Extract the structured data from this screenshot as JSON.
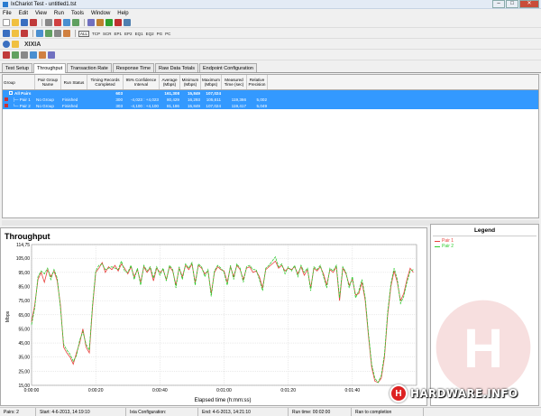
{
  "window": {
    "title": "IxChariot Test - untitled1.tst",
    "min": "–",
    "max": "□",
    "close": "✕"
  },
  "menu": [
    "File",
    "Edit",
    "View",
    "Run",
    "Tools",
    "Window",
    "Help"
  ],
  "toolbar_protocols": [
    "ALL",
    "TCP",
    "SCR",
    "EP1",
    "EP2",
    "EQ1",
    "EQ2",
    "PG",
    "PC"
  ],
  "brand": "XIXIA",
  "tabs": [
    "Test Setup",
    "Throughput",
    "Transaction Rate",
    "Response Time",
    "Raw Data Totals",
    "Endpoint Configuration"
  ],
  "active_tab": "Throughput",
  "grid": {
    "columns": [
      "Group",
      "Pair Group Name",
      "Run Status",
      "Timing Records Completed",
      "95% Confidence Interval",
      "Average (Mbps)",
      "Minimum (Mbps)",
      "Maximum (Mbps)",
      "Measured Time (sec)",
      "Relative Precision"
    ],
    "rows": [
      {
        "group": "All Pairs",
        "pair_group": "",
        "run_status": "",
        "timing": "603",
        "confidence": "",
        "avg": "161,308",
        "min": "15,849",
        "max": "107,024",
        "time": "",
        "precision": ""
      },
      {
        "group": "Pair 1",
        "pair_group": "No Group",
        "run_status": "Finished",
        "timing": "300",
        "confidence": "-4,023 : +4,023",
        "avg": "80,429",
        "min": "16,293",
        "max": "105,611",
        "time": "119,366",
        "precision": "5,002"
      },
      {
        "group": "Pair 2",
        "pair_group": "No Group",
        "run_status": "Finished",
        "timing": "303",
        "confidence": "-4,100 : +4,100",
        "avg": "81,186",
        "min": "15,849",
        "max": "107,024",
        "time": "119,417",
        "precision": "5,049"
      }
    ]
  },
  "legend": {
    "title": "Legend"
  },
  "colors": {
    "pair1": "#e8413c",
    "pair2": "#2ecc2e",
    "selection": "#3399ff"
  },
  "chart_data": {
    "type": "line",
    "title": "Throughput",
    "xlabel": "Elapsed time (h:mm:ss)",
    "ylabel": "Mbps",
    "ylim": [
      15,
      114.75
    ],
    "yticks": [
      "114,75",
      "105,00",
      "95,00",
      "85,00",
      "75,00",
      "65,00",
      "55,00",
      "45,00",
      "35,00",
      "25,00",
      "15,00"
    ],
    "xticks": [
      "0:00:00",
      "0:00:20",
      "0:00:40",
      "0:01:00",
      "0:01:20",
      "0:01:40"
    ],
    "xlim_sec": [
      0,
      120
    ],
    "grid": true,
    "legend_position": "right-pane",
    "series": [
      {
        "name": "Pair 1",
        "x": [
          0,
          1,
          2,
          3,
          4,
          5,
          6,
          7,
          8,
          9,
          10,
          11,
          12,
          13,
          14,
          15,
          16,
          17,
          18,
          19,
          20,
          21,
          22,
          23,
          24,
          25,
          26,
          27,
          28,
          29,
          30,
          31,
          32,
          33,
          34,
          35,
          36,
          37,
          38,
          39,
          40,
          41,
          42,
          43,
          44,
          45,
          46,
          47,
          48,
          49,
          50,
          51,
          52,
          53,
          54,
          55,
          56,
          57,
          58,
          59,
          60,
          61,
          62,
          63,
          64,
          65,
          66,
          67,
          68,
          69,
          70,
          71,
          72,
          73,
          74,
          75,
          76,
          77,
          78,
          79,
          80,
          81,
          82,
          83,
          84,
          85,
          86,
          87,
          88,
          89,
          90,
          91,
          92,
          93,
          94,
          95,
          96,
          97,
          98,
          99,
          100,
          101,
          102,
          103,
          104,
          105,
          106,
          107,
          108,
          109,
          110,
          111,
          112,
          113,
          114,
          115,
          116,
          117,
          118,
          119
        ],
        "values": [
          60,
          72,
          90,
          95,
          88,
          97,
          92,
          96,
          89,
          72,
          42,
          38,
          35,
          30,
          38,
          45,
          55,
          42,
          38,
          70,
          95,
          98,
          102,
          95,
          99,
          97,
          100,
          96,
          101,
          98,
          94,
          99,
          92,
          97,
          88,
          99,
          95,
          98,
          89,
          98,
          95,
          97,
          90,
          99,
          96,
          86,
          98,
          92,
          100,
          97,
          101,
          88,
          100,
          98,
          94,
          96,
          80,
          95,
          99,
          97,
          96,
          88,
          99,
          92,
          100,
          97,
          90,
          98,
          99,
          95,
          96,
          92,
          84,
          97,
          99,
          101,
          103,
          98,
          100,
          96,
          98,
          97,
          99,
          94,
          99,
          93,
          97,
          84,
          98,
          96,
          99,
          94,
          86,
          97,
          95,
          99,
          75,
          98,
          94,
          86,
          90,
          79,
          80,
          88,
          75,
          50,
          28,
          18,
          17,
          20,
          35,
          65,
          85,
          96,
          88,
          75,
          80,
          90,
          98,
          95
        ]
      },
      {
        "name": "Pair 2",
        "x": [
          0,
          1,
          2,
          3,
          4,
          5,
          6,
          7,
          8,
          9,
          10,
          11,
          12,
          13,
          14,
          15,
          16,
          17,
          18,
          19,
          20,
          21,
          22,
          23,
          24,
          25,
          26,
          27,
          28,
          29,
          30,
          31,
          32,
          33,
          34,
          35,
          36,
          37,
          38,
          39,
          40,
          41,
          42,
          43,
          44,
          45,
          46,
          47,
          48,
          49,
          50,
          51,
          52,
          53,
          54,
          55,
          56,
          57,
          58,
          59,
          60,
          61,
          62,
          63,
          64,
          65,
          66,
          67,
          68,
          69,
          70,
          71,
          72,
          73,
          74,
          75,
          76,
          77,
          78,
          79,
          80,
          81,
          82,
          83,
          84,
          85,
          86,
          87,
          88,
          89,
          90,
          91,
          92,
          93,
          94,
          95,
          96,
          97,
          98,
          99,
          100,
          101,
          102,
          103,
          104,
          105,
          106,
          107,
          108,
          109,
          110,
          111,
          112,
          113,
          114,
          115,
          116,
          117,
          118,
          119
        ],
        "values": [
          58,
          70,
          92,
          96,
          94,
          98,
          90,
          97,
          91,
          70,
          44,
          40,
          37,
          32,
          36,
          47,
          53,
          44,
          40,
          72,
          96,
          100,
          101,
          97,
          98,
          99,
          98,
          97,
          103,
          96,
          95,
          100,
          90,
          98,
          86,
          100,
          96,
          99,
          91,
          99,
          93,
          98,
          89,
          100,
          97,
          84,
          99,
          90,
          101,
          98,
          102,
          86,
          101,
          99,
          92,
          97,
          78,
          96,
          100,
          98,
          95,
          86,
          100,
          90,
          101,
          98,
          88,
          99,
          100,
          97,
          97,
          90,
          82,
          98,
          100,
          103,
          106,
          99,
          101,
          94,
          99,
          96,
          100,
          92,
          100,
          95,
          98,
          82,
          99,
          97,
          100,
          92,
          84,
          98,
          96,
          100,
          77,
          99,
          95,
          84,
          92,
          77,
          82,
          90,
          77,
          52,
          30,
          20,
          17,
          22,
          37,
          67,
          87,
          98,
          90,
          73,
          78,
          88,
          96,
          97
        ]
      }
    ]
  },
  "status": [
    "Pairs: 2",
    "Start: 4-6-2013, 14:19:10",
    "Ixia Configuration:",
    "End: 4-6-2013, 14:21:10",
    "Run time: 00:02:00",
    "Ran to completion"
  ],
  "watermark": "HARDWARE.INFO"
}
